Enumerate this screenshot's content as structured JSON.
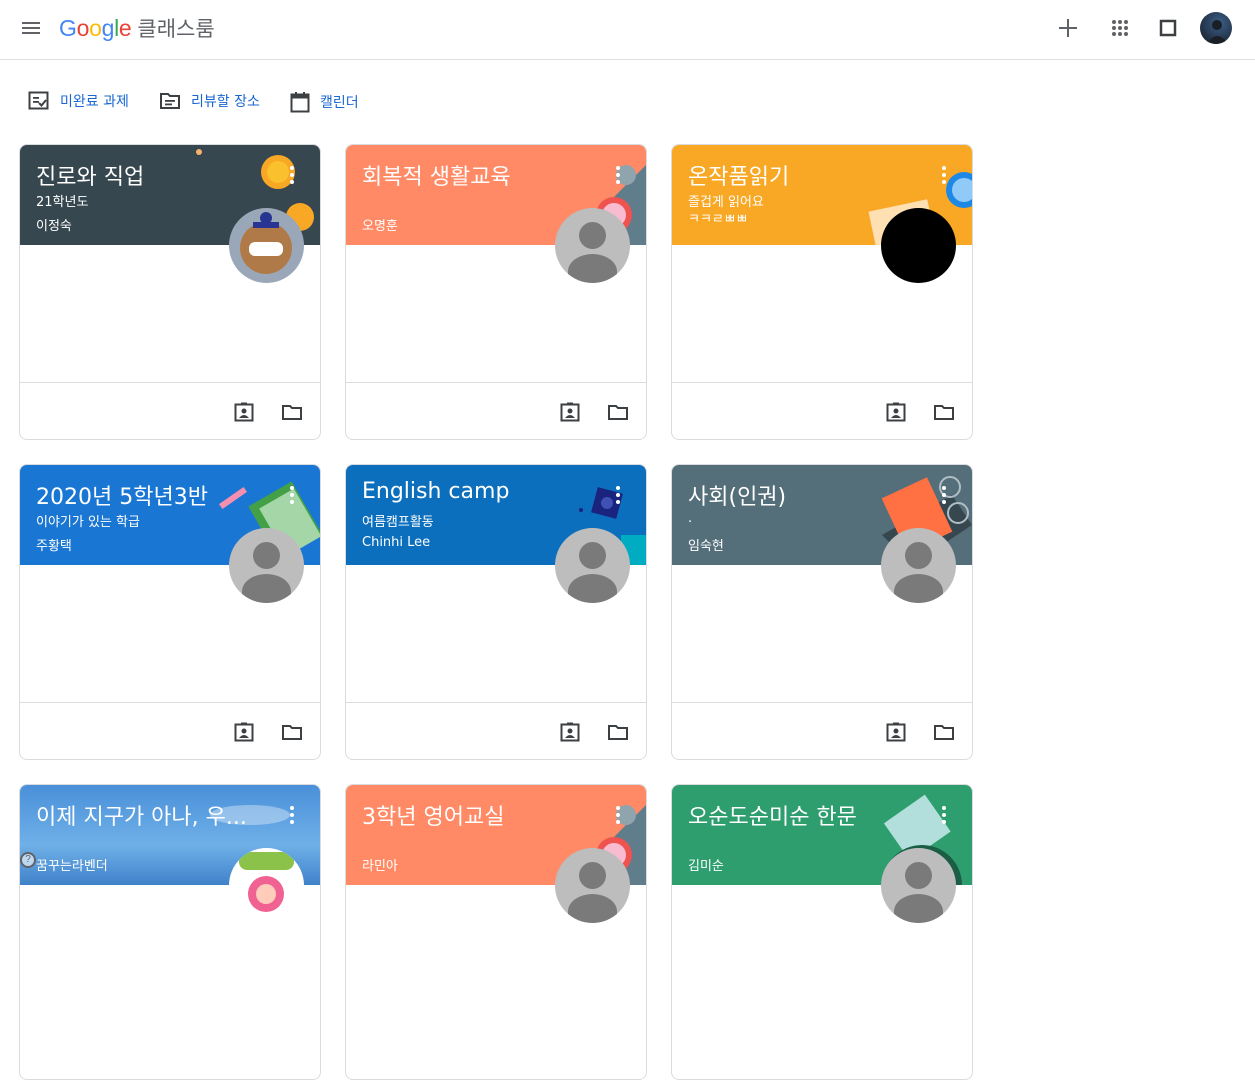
{
  "header": {
    "logo_text": "Google",
    "product_name": "클래스룸",
    "icons": [
      "menu-icon",
      "add-icon",
      "apps-icon",
      "square-icon",
      "account-avatar"
    ]
  },
  "subnav": {
    "items": [
      {
        "label": "미완료 과제",
        "icon": "todo-icon"
      },
      {
        "label": "리뷰할 장소",
        "icon": "review-icon"
      },
      {
        "label": "캘린더",
        "icon": "calendar-icon"
      }
    ]
  },
  "cards": [
    {
      "title": "진로와 직업",
      "section": "21학년도",
      "owner": "이정숙",
      "color": "#37474f",
      "avatar": "photo"
    },
    {
      "title": "회복적 생활교육",
      "section": "",
      "owner": "오명훈",
      "color": "#ff8a65",
      "avatar": "default"
    },
    {
      "title": "온작품읽기",
      "section": "즐겁게 읽어요",
      "owner": "ㅋㅋㄹㅃㅃ",
      "color": "#f9a825",
      "avatar": "black"
    },
    {
      "title": "2020년 5학년3반",
      "section": "이야기가 있는 학급",
      "owner": "주황택",
      "color": "#1976d2",
      "avatar": "default"
    },
    {
      "title": "English camp",
      "section": "여름캠프활동",
      "owner": "Chinhi Lee",
      "color": "#0b6fbd",
      "avatar": "default"
    },
    {
      "title": "사회(인권)",
      "section": ".",
      "owner": "임숙현",
      "color": "#546e7a",
      "avatar": "default"
    },
    {
      "title": "이제 지구가 아나, 우...",
      "section": "",
      "owner": "꿈꾸는라벤더",
      "color": "#3d8fd6",
      "avatar": "photo2"
    },
    {
      "title": "3학년 영어교실",
      "section": "",
      "owner": "라민아",
      "color": "#ff8a65",
      "avatar": "default"
    },
    {
      "title": "오순도순미순 한문",
      "section": "",
      "owner": "김미순",
      "color": "#2e9e6e",
      "avatar": "default"
    }
  ]
}
